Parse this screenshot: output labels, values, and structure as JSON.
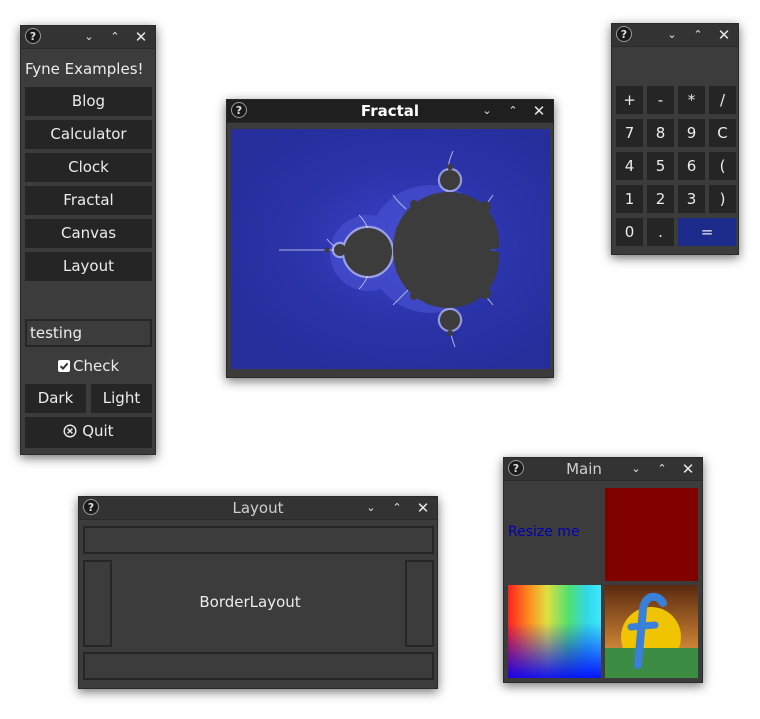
{
  "examples": {
    "title": "Fyne Examples!",
    "buttons": [
      "Blog",
      "Calculator",
      "Clock",
      "Fractal",
      "Canvas",
      "Layout"
    ],
    "entry_value": "testing",
    "check_label": "Check",
    "check_checked": true,
    "dark_label": "Dark",
    "light_label": "Light",
    "quit_label": "Quit"
  },
  "fractal": {
    "title": "Fractal"
  },
  "calculator": {
    "keys": [
      "+",
      "-",
      "*",
      "/",
      "7",
      "8",
      "9",
      "C",
      "4",
      "5",
      "6",
      "(",
      "1",
      "2",
      "3",
      ")",
      "0",
      ".",
      "="
    ]
  },
  "layout": {
    "title": "Layout",
    "center_text": "BorderLayout"
  },
  "main": {
    "title": "Main",
    "label": "Resize me"
  },
  "titlebar": {
    "help": "?",
    "minimize": "⌄",
    "maximize": "⌃",
    "close": "✕"
  },
  "colors": {
    "window_bg": "#3c3c3c",
    "button_bg": "#252525",
    "primary_blue": "#1c2b8a",
    "fractal_bg": "#2a32a8",
    "fractal_set": "#3c3c3c",
    "dark_red": "#800000",
    "link_blue": "#0000b4"
  }
}
